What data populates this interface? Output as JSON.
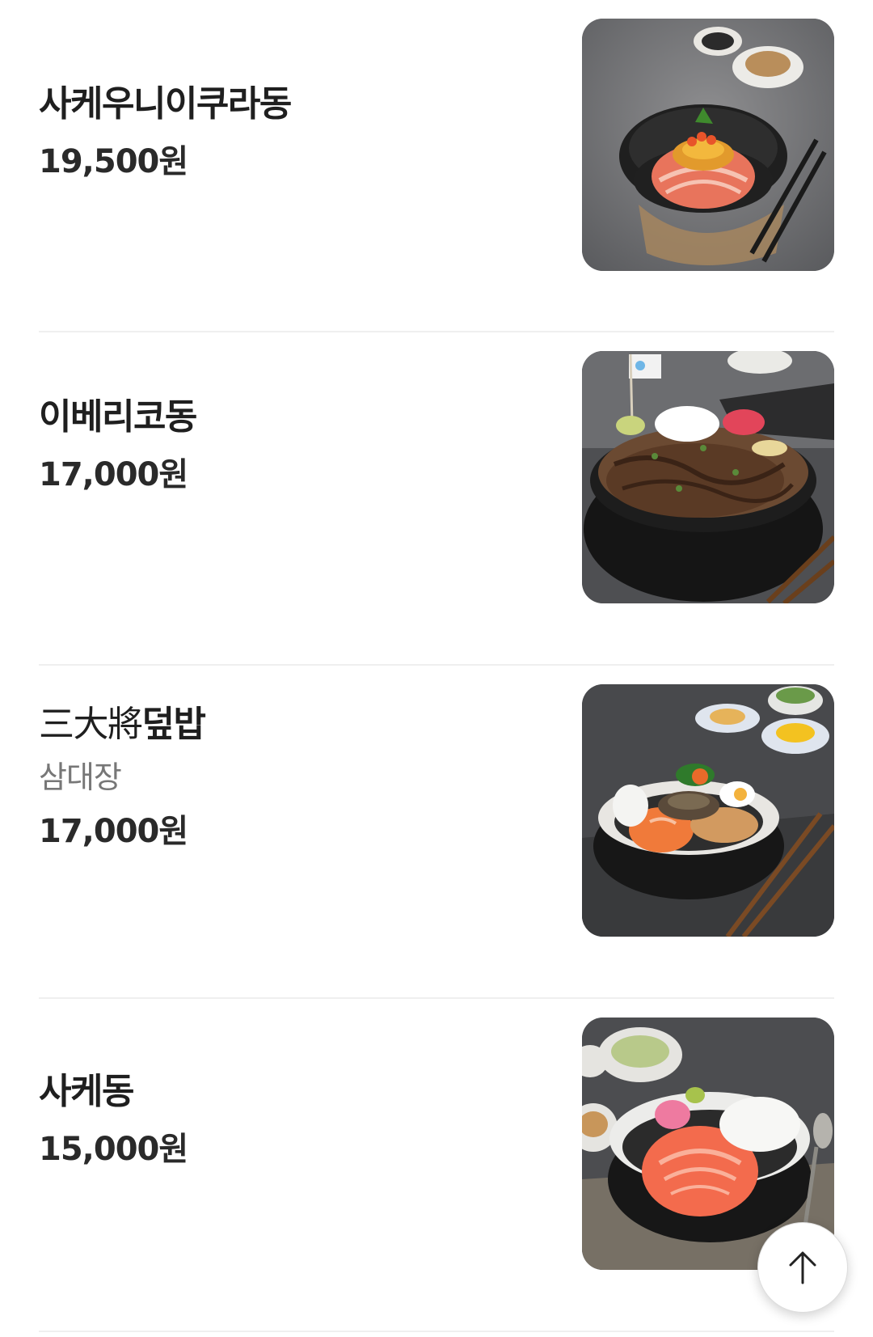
{
  "menu": {
    "items": [
      {
        "name": "사케우니이쿠라동",
        "price": "19,500원",
        "photo_icon": "salmon-uni-ikura-don-photo"
      },
      {
        "name": "이베리코동",
        "price": "17,000원",
        "photo_icon": "iberico-don-photo"
      },
      {
        "name_hanja": "三大將",
        "name_hangul": "덮밥",
        "subname": "삼대장",
        "price": "17,000원",
        "photo_icon": "samdaejang-deopbap-photo"
      },
      {
        "name": "사케동",
        "price": "15,000원",
        "photo_icon": "sake-don-photo"
      }
    ]
  },
  "scroll_top": {
    "icon": "arrow-up-icon"
  },
  "colors": {
    "text_primary": "#1f1f1f",
    "text_secondary": "#777777",
    "divider": "#efefef"
  }
}
